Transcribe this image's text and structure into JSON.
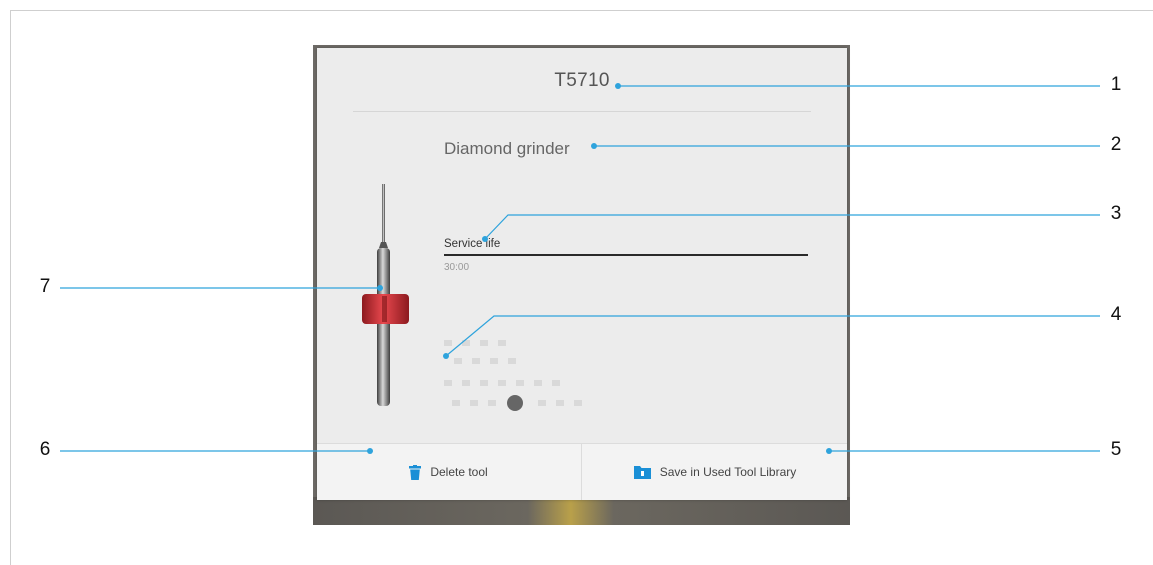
{
  "dialog": {
    "tool_id": "T5710",
    "tool_type": "Diamond grinder",
    "service_life_label": "Service life",
    "service_life_value": "30:00",
    "service_life_fraction": 1.0,
    "delete_label": "Delete tool",
    "save_label": "Save in Used Tool Library"
  },
  "callouts": [
    "1",
    "2",
    "3",
    "4",
    "5",
    "6",
    "7"
  ],
  "colors": {
    "callout_line": "#2ea3dc",
    "accent_icon": "#1a8fd6",
    "tool_collar": "#d8343a"
  },
  "icons": {
    "delete": "trash-icon",
    "save": "folder-icon"
  }
}
